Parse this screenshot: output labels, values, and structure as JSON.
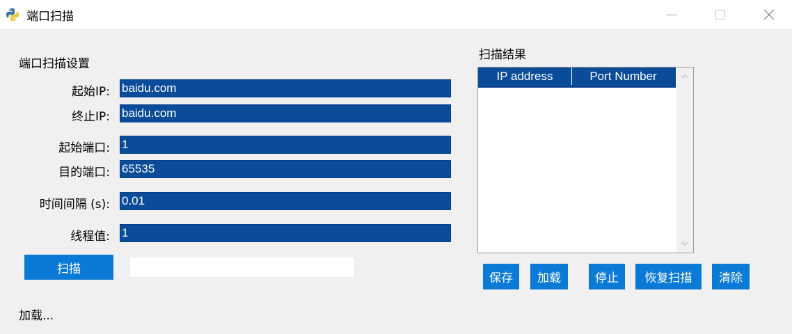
{
  "window": {
    "title": "端口扫描",
    "icon": "python-icon"
  },
  "settings": {
    "section_title": "端口扫描设置",
    "fields": [
      {
        "label": "起始IP:",
        "value": "baidu.com"
      },
      {
        "label": "终止IP:",
        "value": "baidu.com"
      },
      {
        "label": "起始端口:",
        "value": "1"
      },
      {
        "label": "目的端口:",
        "value": "65535"
      },
      {
        "label": "时间间隔 (s):",
        "value": "0.01"
      },
      {
        "label": "线程值:",
        "value": "1"
      }
    ],
    "scan_button": "扫描",
    "progress": 0,
    "status": "加载..."
  },
  "results": {
    "section_title": "扫描结果",
    "columns": [
      "IP address",
      "Port Number"
    ],
    "rows": []
  },
  "actions": {
    "save": "保存",
    "load": "加载",
    "stop": "停止",
    "resume": "恢复扫描",
    "clear": "清除"
  },
  "colors": {
    "input_bg": "#0a4c9a",
    "button_bg": "#0a7ad6"
  }
}
